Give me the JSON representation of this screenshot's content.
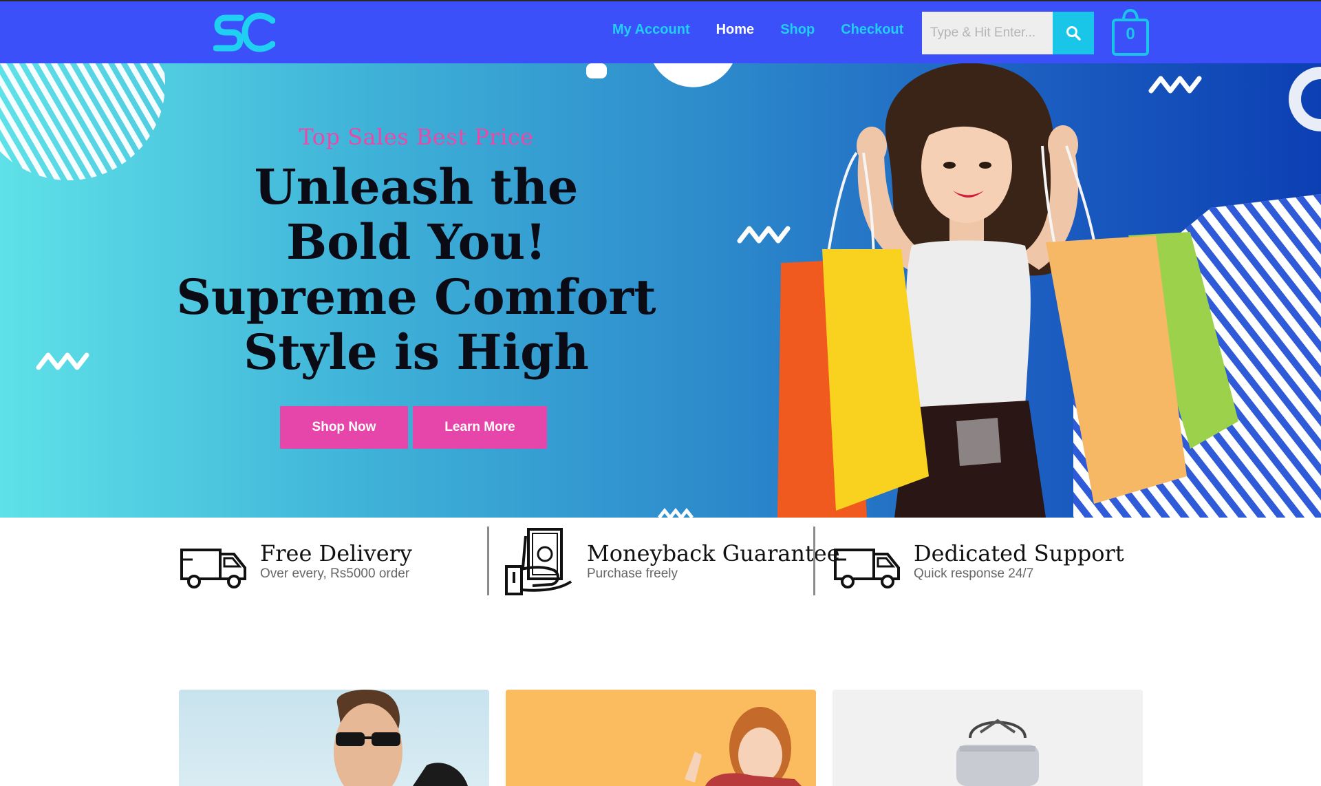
{
  "header": {
    "logo_text": "SC",
    "nav": [
      {
        "label": "My Account",
        "active": false
      },
      {
        "label": "Home",
        "active": true
      },
      {
        "label": "Shop",
        "active": false
      },
      {
        "label": "Checkout",
        "active": false
      }
    ],
    "search_placeholder": "Type & Hit Enter...",
    "cart_count": "0",
    "icons": {
      "search": "search-icon",
      "cart": "shopping-bag-icon"
    },
    "colors": {
      "bar": "#3c50fa",
      "accent": "#19c6e8",
      "active_link": "#ffffff"
    }
  },
  "hero": {
    "subtitle": "Top Sales Best Price",
    "title_lines": [
      "Unleash the",
      "Bold You!",
      "Supreme Comfort",
      "Style is High"
    ],
    "buttons": {
      "shop": "Shop Now",
      "learn": "Learn More"
    },
    "colors": {
      "subtitle": "#e94aa8",
      "button": "#e646a9"
    }
  },
  "features": [
    {
      "title": "Free Delivery",
      "subtitle": "Over every, Rs5000 order",
      "icon": "delivery-truck-icon"
    },
    {
      "title": "Moneyback Guarantee",
      "subtitle": "Purchase freely",
      "icon": "money-hand-icon"
    },
    {
      "title": "Dedicated Support",
      "subtitle": "Quick response 24/7",
      "icon": "delivery-truck-icon"
    }
  ]
}
